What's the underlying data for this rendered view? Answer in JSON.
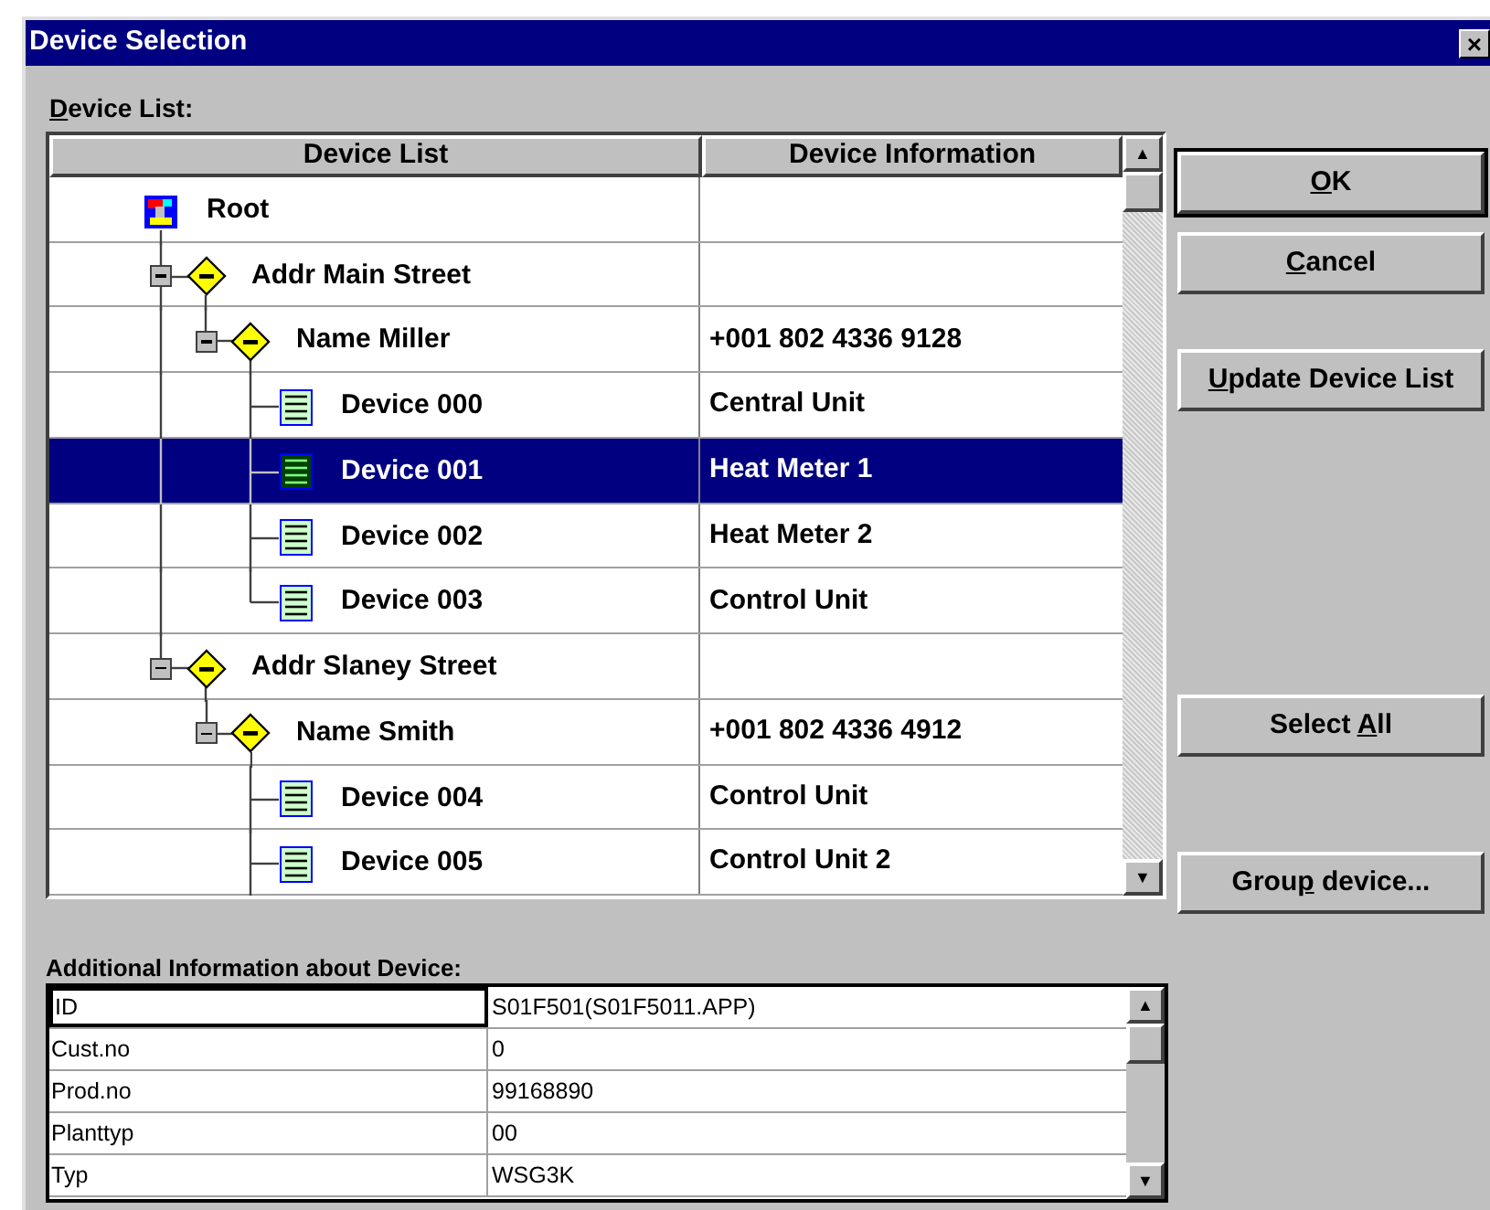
{
  "window": {
    "title": "Device Selection",
    "close": "×"
  },
  "device_list_label": {
    "key": "D",
    "post": "evice List:"
  },
  "table": {
    "columns": [
      "Device List",
      "Device Information"
    ],
    "scroll_up": "▲",
    "scroll_down": "▼",
    "tree": [
      {
        "kind": "root",
        "label": "Root",
        "selected": false,
        "expanded": true,
        "children": [
          {
            "kind": "group",
            "label": "Addr Main Street",
            "selected": false,
            "expanded": true,
            "children": [
              {
                "kind": "group",
                "label": "Name Miller",
                "info": "+001 802 4336 9128",
                "selected": false,
                "expanded": true,
                "children": [
                  {
                    "kind": "device",
                    "label": "Device 000",
                    "info": "Central Unit",
                    "selected": false
                  },
                  {
                    "kind": "device",
                    "label": "Device 001",
                    "info": "Heat Meter 1",
                    "selected": true
                  },
                  {
                    "kind": "device",
                    "label": "Device 002",
                    "info": "Heat Meter 2",
                    "selected": false
                  },
                  {
                    "kind": "device",
                    "label": "Device 003",
                    "info": "Control Unit",
                    "selected": false
                  }
                ]
              }
            ]
          },
          {
            "kind": "group",
            "label": "Addr Slaney Street",
            "selected": false,
            "expanded": true,
            "children": [
              {
                "kind": "group",
                "label": "Name Smith",
                "info": "+001 802 4336 4912",
                "selected": false,
                "expanded": true,
                "children": [
                  {
                    "kind": "device",
                    "label": "Device 004",
                    "info": "Control Unit",
                    "selected": false
                  },
                  {
                    "kind": "device",
                    "label": "Device 005",
                    "info": "Control Unit 2",
                    "selected": false
                  }
                ]
              }
            ]
          }
        ]
      }
    ]
  },
  "buttons": [
    {
      "key": "O",
      "post": "K",
      "default": true
    },
    {
      "key": "C",
      "post": "ancel",
      "default": false
    },
    {
      "key": "U",
      "post": "pdate Device List",
      "default": false
    },
    {
      "pre": "Select ",
      "key": "A",
      "post": "ll",
      "default": false
    },
    {
      "pre": "Grou",
      "key": "p",
      "post": " device...",
      "default": false
    }
  ],
  "info": {
    "title": "Additional Information about Device:",
    "scroll_up": "▲",
    "scroll_down": "▼",
    "rows": [
      {
        "label": "ID",
        "value": "S01F501(S01F5011.APP)",
        "focused": true
      },
      {
        "label": "Cust.no",
        "value": "0",
        "focused": false
      },
      {
        "label": "Prod.no",
        "value": "99168890",
        "focused": false
      },
      {
        "label": "Planttyp",
        "value": "00",
        "focused": false
      },
      {
        "label": "Typ",
        "value": "WSG3K",
        "focused": false
      }
    ]
  }
}
